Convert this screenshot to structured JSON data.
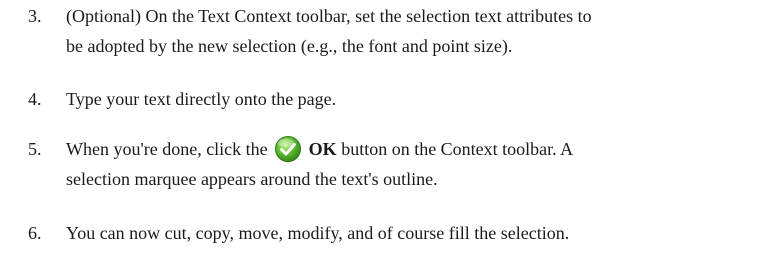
{
  "steps": [
    {
      "number": "3.",
      "line1": "(Optional) On the Text Context toolbar, set the selection text attributes to",
      "line2": "be adopted by the new selection (e.g., the font and point size)."
    },
    {
      "number": "4.",
      "line1": "Type your text directly onto the page."
    },
    {
      "number": "5.",
      "before": "When you're done, click the",
      "icon": "ok-checkmark-icon",
      "bold": "OK",
      "after": "button on the Context toolbar. A",
      "line2": "selection marquee appears around the text's outline."
    },
    {
      "number": "6.",
      "line1": "You can now cut, copy, move, modify, and of course fill the selection."
    }
  ],
  "colors": {
    "text": "#1a1a1a",
    "icon_green": "#5cb82f"
  }
}
